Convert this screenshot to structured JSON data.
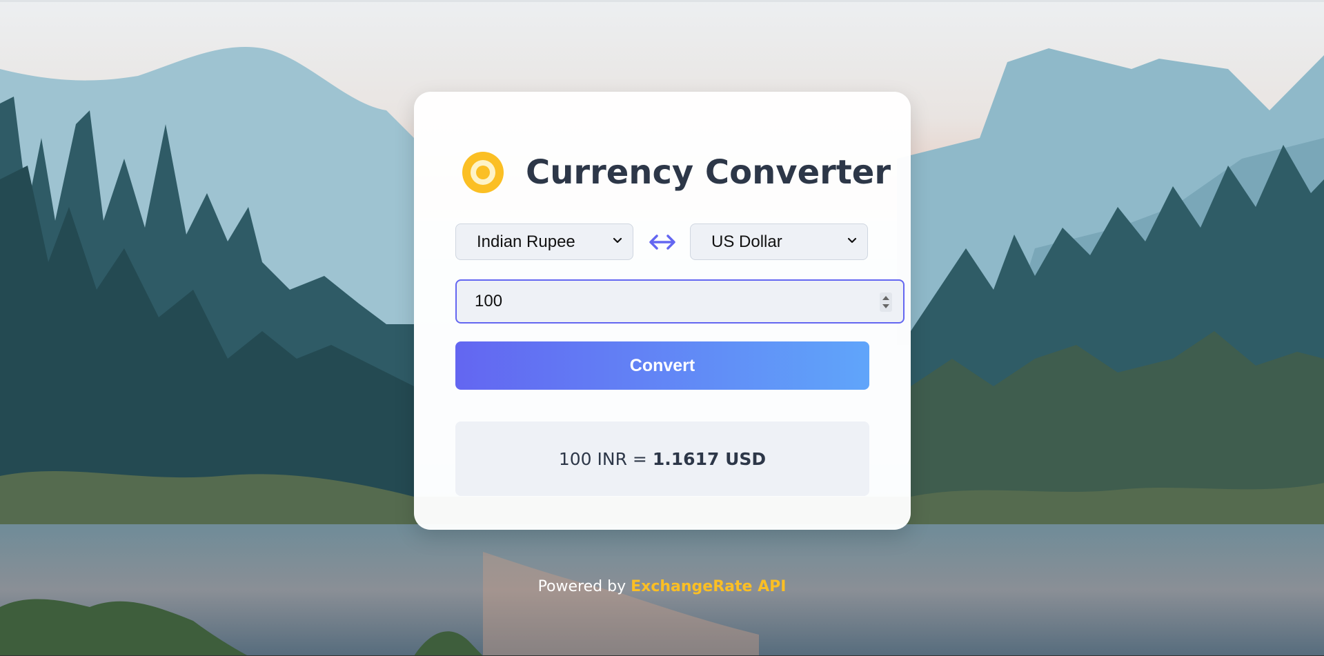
{
  "app": {
    "title": "Currency Converter",
    "icon": "coin-icon"
  },
  "converter": {
    "from_currency": "Indian Rupee",
    "to_currency": "US Dollar",
    "swap_icon": "swap-arrows-icon",
    "amount_value": "100",
    "convert_label": "Convert",
    "result_prefix": "100 INR =",
    "result_value": "1.1617 USD"
  },
  "footer": {
    "powered_prefix": "Powered by",
    "powered_link": "ExchangeRate API"
  },
  "colors": {
    "accent": "#6366f1",
    "accent_end": "#60a5fa",
    "coin": "#fbbf24",
    "link": "#fbbf24",
    "title_text": "#2d3748"
  }
}
